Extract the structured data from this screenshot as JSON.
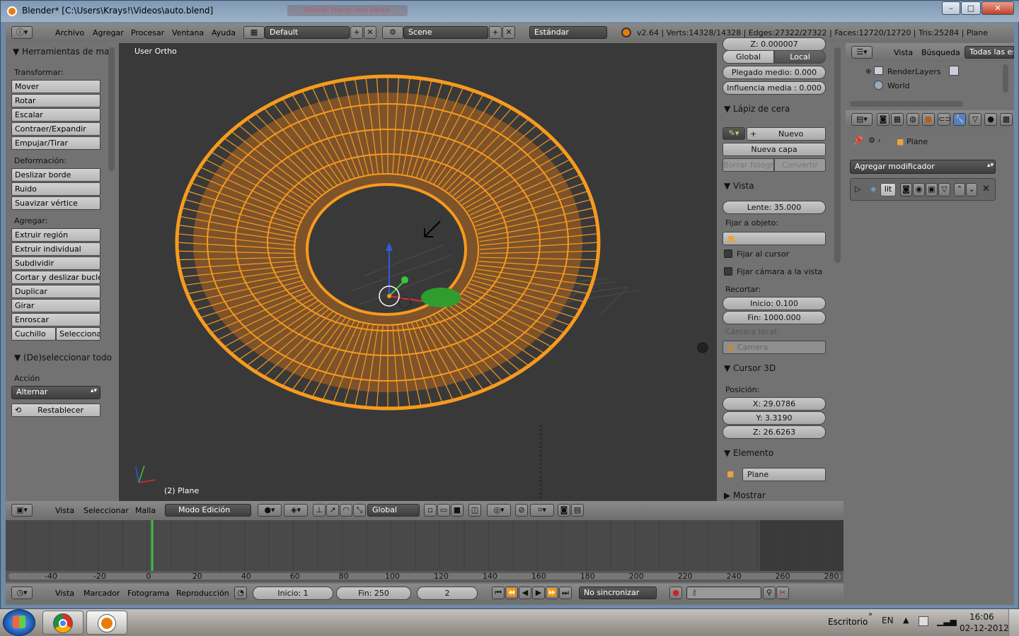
{
  "window": {
    "title": "Blender* [C:\\Users\\Krays!\\Videos\\auto.blend]",
    "bg_tabs": [
      "Tutorial Hacer una llanta"
    ],
    "min_label": "–",
    "max_label": "□",
    "close_label": "✕"
  },
  "info_header": {
    "menus": [
      "Archivo",
      "Agregar",
      "Procesar",
      "Ventana",
      "Ayuda"
    ],
    "screen_layout": "Default",
    "scene": "Scene",
    "render_engine": "Estándar",
    "stats": "v2.64 | Verts:14328/14328 | Edges:27322/27322 | Faces:12720/12720 | Tris:25284 | Plane"
  },
  "toolshelf": {
    "title": "Herramientas de mal",
    "sections": [
      {
        "label": "Transformar:",
        "buttons": [
          "Mover",
          "Rotar",
          "Escalar",
          "Contraer/Expandir",
          "Empujar/Tirar"
        ]
      },
      {
        "label": "Deformación:",
        "buttons": [
          "Deslizar borde",
          "Ruido",
          "Suavizar vértice"
        ]
      },
      {
        "label": "Agregar:",
        "buttons": [
          "Extruir región",
          "Extruir individual",
          "Subdividir",
          "Cortar y deslizar bucle",
          "Duplicar",
          "Girar",
          "Enroscar"
        ]
      }
    ],
    "split_buttons": [
      "Cuchillo",
      "Seleccionar"
    ],
    "operator_title": "(De)seleccionar todo",
    "accion_label": "Acción",
    "accion_value": "Alternar",
    "reset_label": "Restablecer"
  },
  "viewport": {
    "view_name": "User Ortho",
    "object_label": "(2) Plane",
    "mesh_color": "#f79a1e",
    "bg_color": "#393939"
  },
  "view3d_header": {
    "menus": [
      "Vista",
      "Seleccionar",
      "Malla"
    ],
    "mode": "Modo Edición",
    "orientation": "Global"
  },
  "npanel": {
    "top_cut": "Z: 0.000007",
    "global_label": "Global",
    "local_label": "Local",
    "plegado": "Plegado medio: 0.000",
    "influencia": "Influencia media : 0.000",
    "lapiz_title": "Lápiz de cera",
    "nuevo_label": "Nuevo",
    "nueva_capa": "Nueva capa",
    "borrar": "Borrar fotogra",
    "convertir": "Convertir",
    "vista_title": "Vista",
    "lente": "Lente: 35.000",
    "fijar_obj": "Fijar a objeto:",
    "fijar_cursor": "Fijar al cursor",
    "fijar_camara": "Fijar cámara a la vista",
    "recortar": "Recortar:",
    "inicio": "Inicio: 0.100",
    "fin": "Fin: 1000.000",
    "camara_local": "Cámara local:",
    "camera": "Camera",
    "cursor_title": "Cursor 3D",
    "posicion": "Posición:",
    "cx": "X: 29.0786",
    "cy": "Y: 3.3190",
    "cz": "Z: 26.6263",
    "elemento_title": "Elemento",
    "elemento_value": "Plane",
    "mostrar_title": "Mostrar"
  },
  "outliner": {
    "menus": [
      "Vista",
      "Búsqueda"
    ],
    "filter": "Todas las esc",
    "items": [
      "RenderLayers",
      "World"
    ]
  },
  "properties": {
    "breadcrumb": "Plane",
    "add_modifier": "Agregar modificador",
    "modifier_name": "lit"
  },
  "timeline": {
    "ticks": [
      "-40",
      "-20",
      "0",
      "20",
      "40",
      "60",
      "80",
      "100",
      "120",
      "140",
      "160",
      "180",
      "200",
      "220",
      "240",
      "260",
      "280"
    ],
    "menus": [
      "Vista",
      "Marcador",
      "Fotograma",
      "Reproducción"
    ],
    "start": "Inicio: 1",
    "end": "Fin: 250",
    "current": "2",
    "sync": "No sincronizar"
  },
  "taskbar": {
    "desktop_label": "Escritorio",
    "lang": "EN",
    "time": "16:06",
    "date": "02-12-2012"
  }
}
